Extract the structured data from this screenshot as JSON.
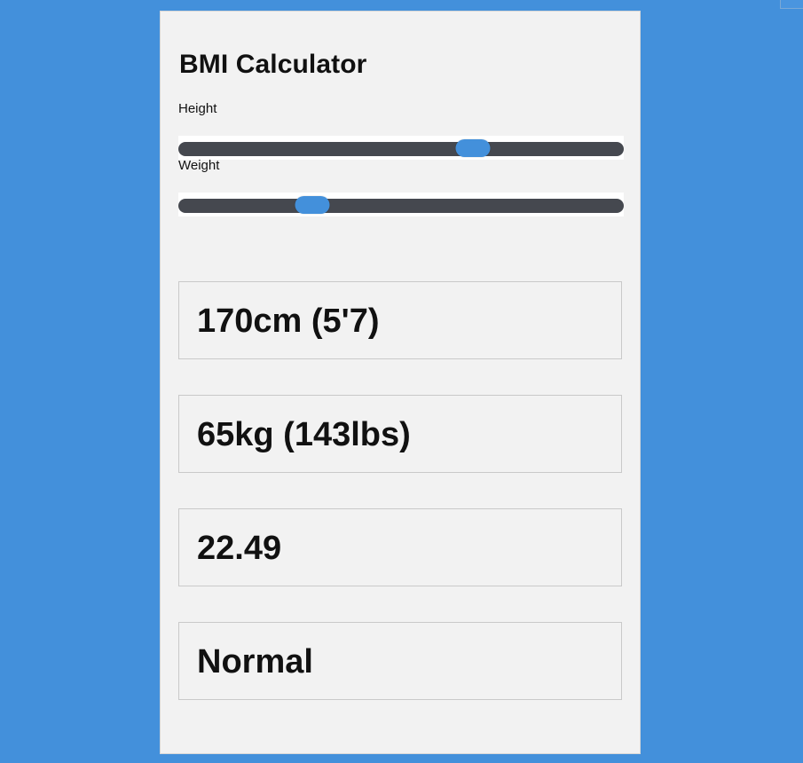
{
  "app": {
    "title": "BMI Calculator"
  },
  "controls": {
    "height": {
      "label": "Height",
      "value_fraction": 0.675
    },
    "weight": {
      "label": "Weight",
      "value_fraction": 0.285
    }
  },
  "results": {
    "height": "170cm (5'7)",
    "weight": "65kg (143lbs)",
    "bmi": "22.49",
    "category": "Normal"
  },
  "colors": {
    "background": "#4390db",
    "card": "#f2f2f2",
    "track": "#45484f",
    "thumb": "#4390db"
  }
}
